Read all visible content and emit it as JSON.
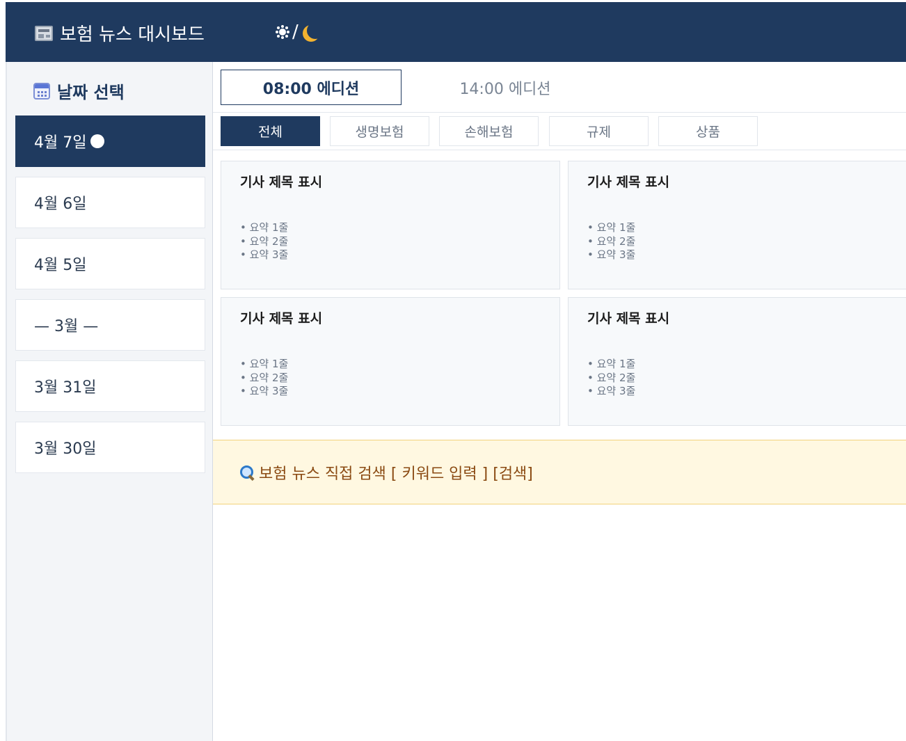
{
  "header": {
    "title": "보험 뉴스 대시보드",
    "theme_toggle_separator": "/"
  },
  "sidebar": {
    "title": "날짜 선택",
    "dates": [
      {
        "label": "4월 7일",
        "active": true
      },
      {
        "label": "4월 6일"
      },
      {
        "label": "4월 5일"
      },
      {
        "label": "— 3월 —",
        "divider": true
      },
      {
        "label": "3월 31일"
      },
      {
        "label": "3월 30일"
      }
    ]
  },
  "editions": [
    {
      "label": "08:00 에디션",
      "active": true
    },
    {
      "label": "14:00 에디션",
      "active": false
    }
  ],
  "tabs": [
    {
      "label": "전체",
      "active": true
    },
    {
      "label": "생명보험"
    },
    {
      "label": "손해보험"
    },
    {
      "label": "규제"
    },
    {
      "label": "상품"
    }
  ],
  "cards": [
    {
      "title": "기사 제목 표시",
      "bullets": [
        "• 요약 1줄",
        "• 요약 2줄",
        "• 요약 3줄"
      ]
    },
    {
      "title": "기사 제목 표시",
      "bullets": [
        "• 요약 1줄",
        "• 요약 2줄",
        "• 요약 3줄"
      ]
    },
    {
      "title": "기사 제목 표시",
      "bullets": [
        "• 요약 1줄",
        "• 요약 2줄",
        "• 요약 3줄"
      ]
    },
    {
      "title": "기사 제목 표시",
      "bullets": [
        "• 요약 1줄",
        "• 요약 2줄",
        "• 요약 3줄"
      ]
    }
  ],
  "search": {
    "text": "보험 뉴스 직접 검색 [ 키워드 입력 ] [검색]"
  },
  "colors": {
    "primary": "#1f3a5f",
    "search_bg": "#fff8e1",
    "search_text": "#8a4a12"
  }
}
